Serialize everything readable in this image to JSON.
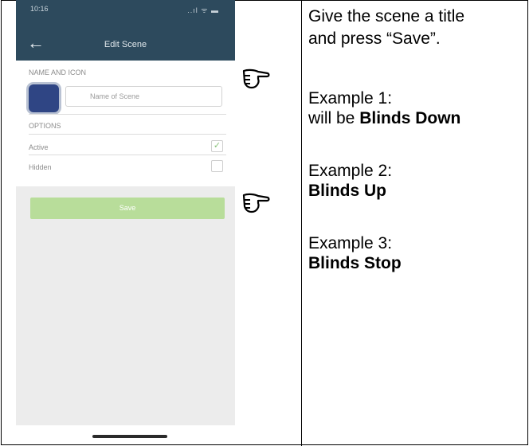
{
  "phone": {
    "status_bar": {
      "time": "10:16",
      "icons": "..ıl ᯤ ▬"
    },
    "nav": {
      "back_icon": "back-arrow-icon",
      "title": "Edit Scene"
    },
    "name_section": {
      "label": "NAME AND ICON",
      "input_placeholder": "Name of Scene"
    },
    "options_section": {
      "label": "OPTIONS",
      "items": [
        {
          "label": "Active",
          "checked": true
        },
        {
          "label": "Hidden",
          "checked": false
        }
      ]
    },
    "save_button": "Save"
  },
  "pointers": {
    "icon": "pointing-hand-icon"
  },
  "instructions": {
    "intro_line1": "Give the scene a title",
    "intro_line2": "and press “Save”.",
    "example1_label": "Example 1:",
    "example1_prefix": "will be ",
    "example1_value": "Blinds Down",
    "example2_label": "Example 2:",
    "example2_value": "Blinds Up",
    "example3_label": "Example 3:",
    "example3_value": "Blinds Stop"
  }
}
